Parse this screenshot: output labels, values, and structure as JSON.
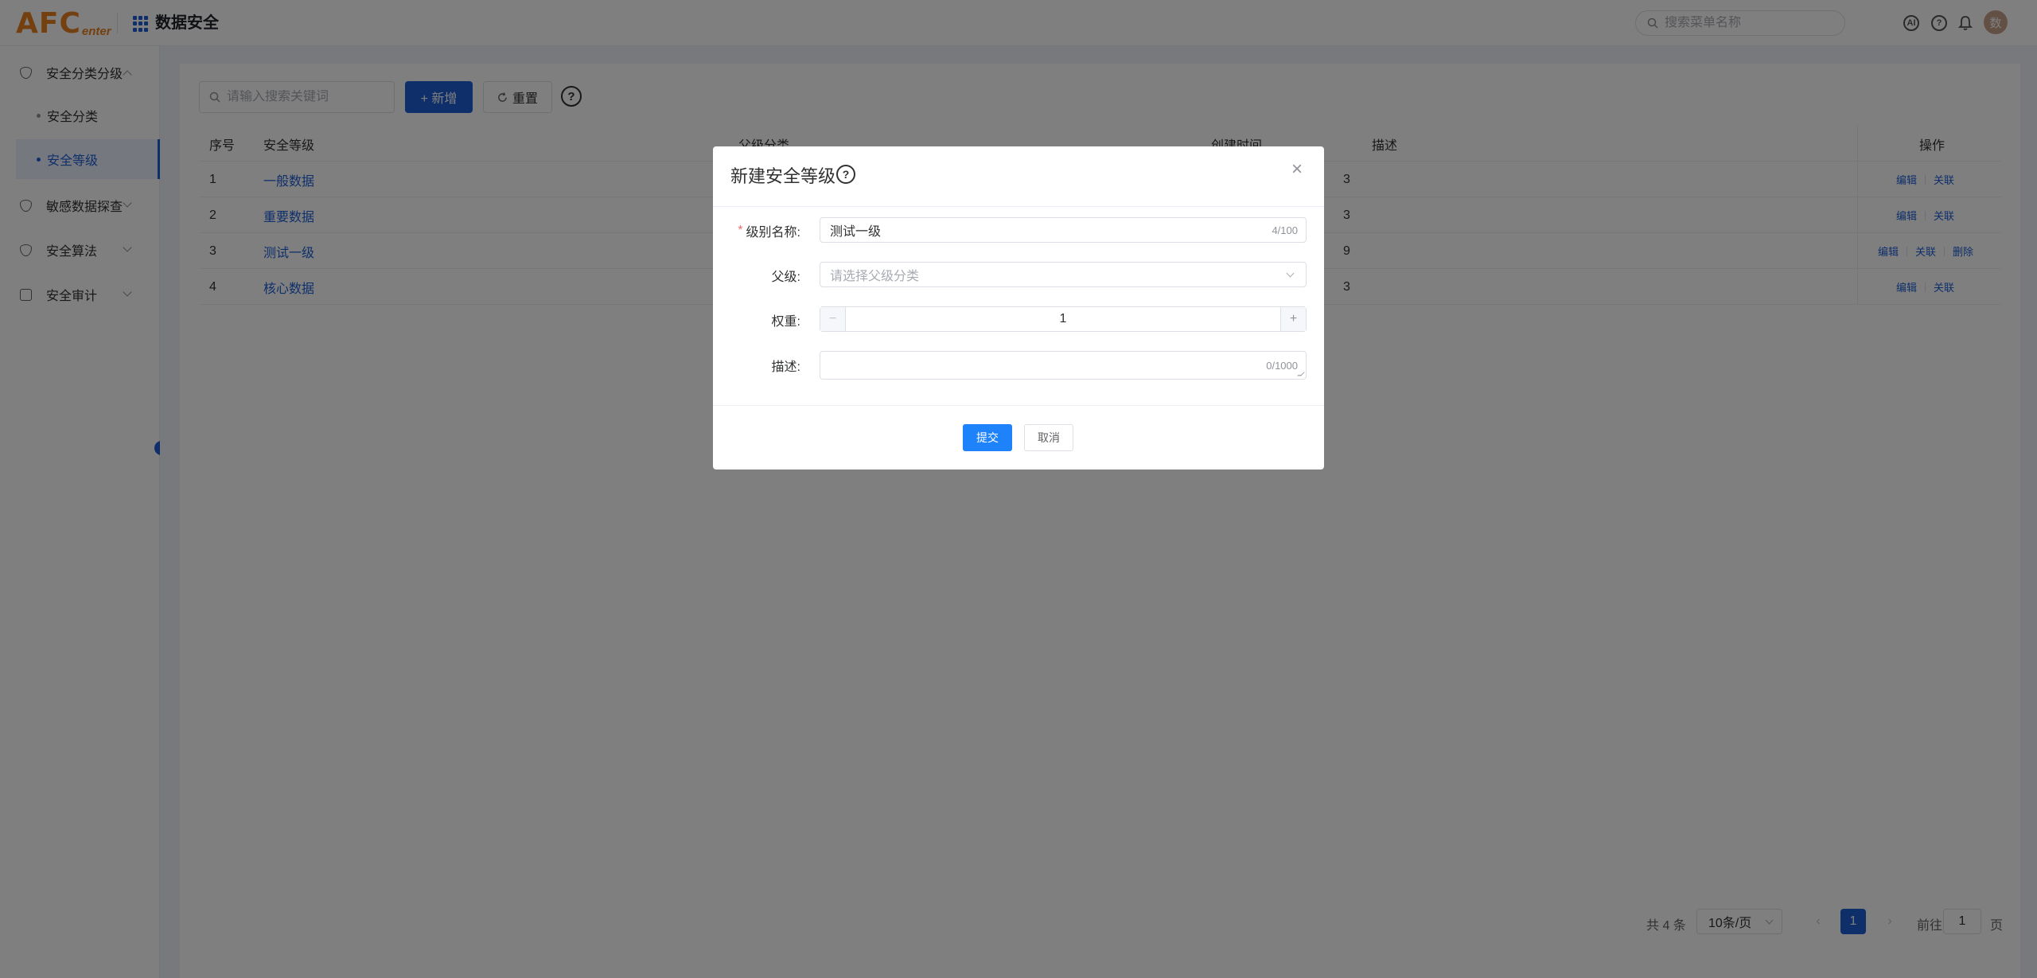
{
  "header": {
    "logo_main": "AFC",
    "logo_sub": "enter",
    "app_title": "数据安全",
    "search_placeholder": "搜索菜单名称",
    "ai_icon_label": "AI",
    "help_icon_label": "?",
    "avatar_text": "数"
  },
  "sidebar": {
    "groups": [
      {
        "label": "安全分类分级",
        "icon": "shield-icon",
        "expanded": true
      },
      {
        "label": "敏感数据探查",
        "icon": "shield-icon",
        "expanded": false
      },
      {
        "label": "安全算法",
        "icon": "shield-icon",
        "expanded": false
      },
      {
        "label": "安全审计",
        "icon": "audit-icon",
        "expanded": false
      }
    ],
    "sub_items": [
      {
        "label": "安全分类",
        "active": false
      },
      {
        "label": "安全等级",
        "active": true
      }
    ]
  },
  "toolbar": {
    "search_placeholder": "请输入搜索关键词",
    "add_label": "+ 新增",
    "reset_label": "重置",
    "help_label": "?"
  },
  "table": {
    "headers": {
      "index": "序号",
      "level": "安全等级",
      "parent": "父级分类",
      "created": "创建时间",
      "desc": "描述",
      "ops": "操作"
    },
    "rows": [
      {
        "index": "1",
        "level": "一般数据",
        "created_tail": "3",
        "ops": [
          "编辑",
          "关联"
        ]
      },
      {
        "index": "2",
        "level": "重要数据",
        "created_tail": "3",
        "ops": [
          "编辑",
          "关联"
        ]
      },
      {
        "index": "3",
        "level": "测试一级",
        "created_tail": "9",
        "ops": [
          "编辑",
          "关联",
          "删除"
        ]
      },
      {
        "index": "4",
        "level": "核心数据",
        "created_tail": "3",
        "ops": [
          "编辑",
          "关联"
        ]
      }
    ]
  },
  "pagination": {
    "total": "共 4 条",
    "page_size": "10条/页",
    "prev": "‹",
    "current": "1",
    "next": "›",
    "goto_prefix": "前往",
    "goto_value": "1",
    "goto_suffix": "页"
  },
  "dialog": {
    "title": "新建安全等级",
    "help_label": "?",
    "close_label": "×",
    "fields": {
      "name_label": "级别名称:",
      "name_required": "*",
      "name_value": "测试一级",
      "name_count": "4/100",
      "parent_label": "父级:",
      "parent_placeholder": "请选择父级分类",
      "weight_label": "权重:",
      "weight_value": "1",
      "weight_minus": "−",
      "weight_plus": "+",
      "desc_label": "描述:",
      "desc_count": "0/1000"
    },
    "submit_label": "提交",
    "cancel_label": "取消"
  },
  "colors": {
    "primary": "#1e5fd6",
    "submit": "#1e82fa",
    "logo": "#e8801e",
    "required": "#f56c6c"
  }
}
